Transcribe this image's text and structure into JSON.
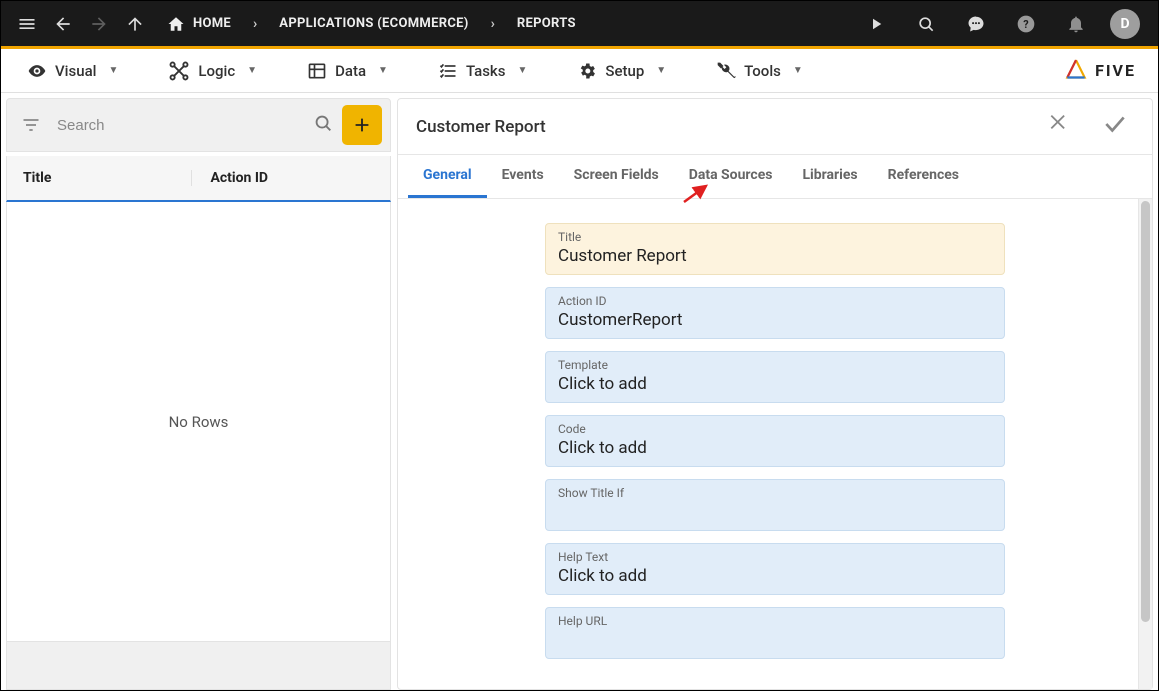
{
  "breadcrumb": {
    "home": "HOME",
    "app": "APPLICATIONS (ECOMMERCE)",
    "section": "REPORTS"
  },
  "topbar_user_initial": "D",
  "menus": {
    "visual": "Visual",
    "logic": "Logic",
    "data": "Data",
    "tasks": "Tasks",
    "setup": "Setup",
    "tools": "Tools"
  },
  "brand": "FIVE",
  "list": {
    "search_placeholder": "Search",
    "columns": {
      "title": "Title",
      "action_id": "Action ID"
    },
    "empty_text": "No Rows"
  },
  "detail": {
    "header_title": "Customer Report",
    "tabs": {
      "general": "General",
      "events": "Events",
      "screen_fields": "Screen Fields",
      "data_sources": "Data Sources",
      "libraries": "Libraries",
      "references": "References"
    },
    "fields": {
      "title_label": "Title",
      "title_value": "Customer Report",
      "action_id_label": "Action ID",
      "action_id_value": "CustomerReport",
      "template_label": "Template",
      "template_value": "Click to add",
      "code_label": "Code",
      "code_value": "Click to add",
      "show_title_if_label": "Show Title If",
      "show_title_if_value": "",
      "help_text_label": "Help Text",
      "help_text_value": "Click to add",
      "help_url_label": "Help URL",
      "help_url_value": ""
    }
  }
}
